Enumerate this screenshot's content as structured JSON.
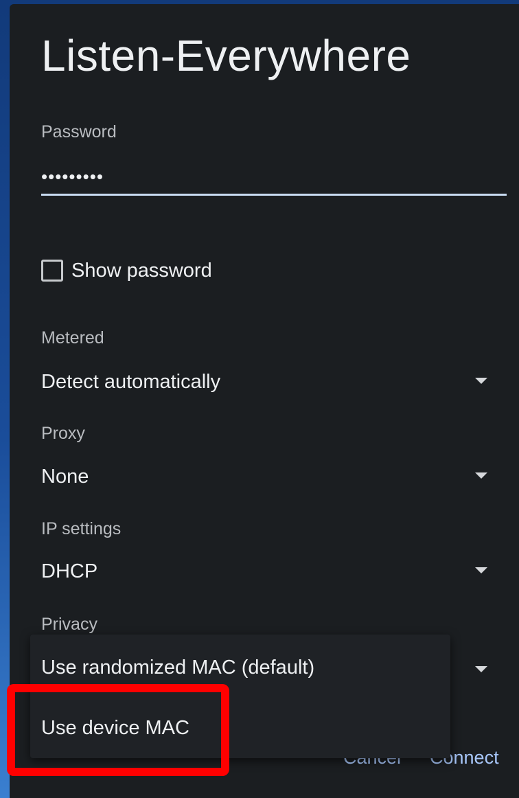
{
  "dialog": {
    "title": "Listen-Everywhere"
  },
  "password": {
    "label": "Password",
    "value": "•••••••••"
  },
  "show_password": {
    "label": "Show password",
    "checked": false
  },
  "metered": {
    "label": "Metered",
    "value": "Detect automatically"
  },
  "proxy": {
    "label": "Proxy",
    "value": "None"
  },
  "ip_settings": {
    "label": "IP settings",
    "value": "DHCP"
  },
  "privacy": {
    "label": "Privacy",
    "value": "Use randomized MAC (default)",
    "options": [
      "Use randomized MAC (default)",
      "Use device MAC"
    ]
  },
  "footer": {
    "cancel_label": "Cancel",
    "connect_label": "Connect"
  },
  "colors": {
    "dialog_bg": "#1b1e21",
    "accent": "#a8c7fa",
    "highlight": "#ff0000"
  },
  "icons": {
    "dropdown": "caret-down-icon",
    "checkbox": "checkbox-unchecked-icon"
  }
}
